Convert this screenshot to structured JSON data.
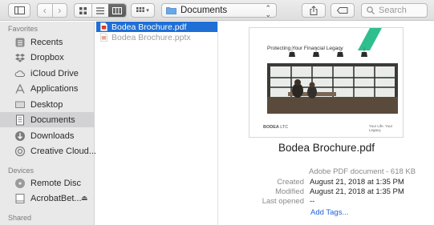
{
  "toolbar": {
    "path_folder": "Documents",
    "search_placeholder": "Search"
  },
  "sidebar": {
    "sections": {
      "favorites": "Favorites",
      "devices": "Devices",
      "shared": "Shared"
    },
    "favorites": [
      {
        "label": "Recents",
        "icon": "recents-icon"
      },
      {
        "label": "Dropbox",
        "icon": "dropbox-icon"
      },
      {
        "label": "iCloud Drive",
        "icon": "icloud-icon"
      },
      {
        "label": "Applications",
        "icon": "applications-icon"
      },
      {
        "label": "Desktop",
        "icon": "desktop-icon"
      },
      {
        "label": "Documents",
        "icon": "documents-icon",
        "active": true
      },
      {
        "label": "Downloads",
        "icon": "downloads-icon"
      },
      {
        "label": "Creative Cloud...",
        "icon": "creative-cloud-icon"
      }
    ],
    "devices": [
      {
        "label": "Remote Disc",
        "icon": "disc-icon"
      },
      {
        "label": "AcrobatBet...",
        "icon": "drive-icon",
        "ejectable": true
      }
    ]
  },
  "files": [
    {
      "name": "Bodea Brochure.pdf",
      "icon": "pdf-file-icon",
      "selected": true
    },
    {
      "name": "Bodea Brochure.pptx",
      "icon": "pptx-file-icon",
      "selected": false
    }
  ],
  "preview": {
    "thumbnail": {
      "title": "Protecting Your Financial Legacy",
      "brand": "BODEA",
      "brand_suffix": "LTC",
      "tagline": "Your Life. Your Legacy."
    },
    "file_name": "Bodea Brochure.pdf",
    "kind": "Adobe PDF document - 618 KB",
    "meta": [
      {
        "key": "Created",
        "value": "August 21, 2018 at 1:35 PM"
      },
      {
        "key": "Modified",
        "value": "August 21, 2018 at 1:35 PM"
      },
      {
        "key": "Last opened",
        "value": "--"
      }
    ],
    "add_tags": "Add Tags..."
  },
  "colors": {
    "selection": "#1f6fd6",
    "sidebar_bg": "#e9e9ea",
    "link": "#2463d8",
    "thumb_accent": "#2fbf8f"
  }
}
